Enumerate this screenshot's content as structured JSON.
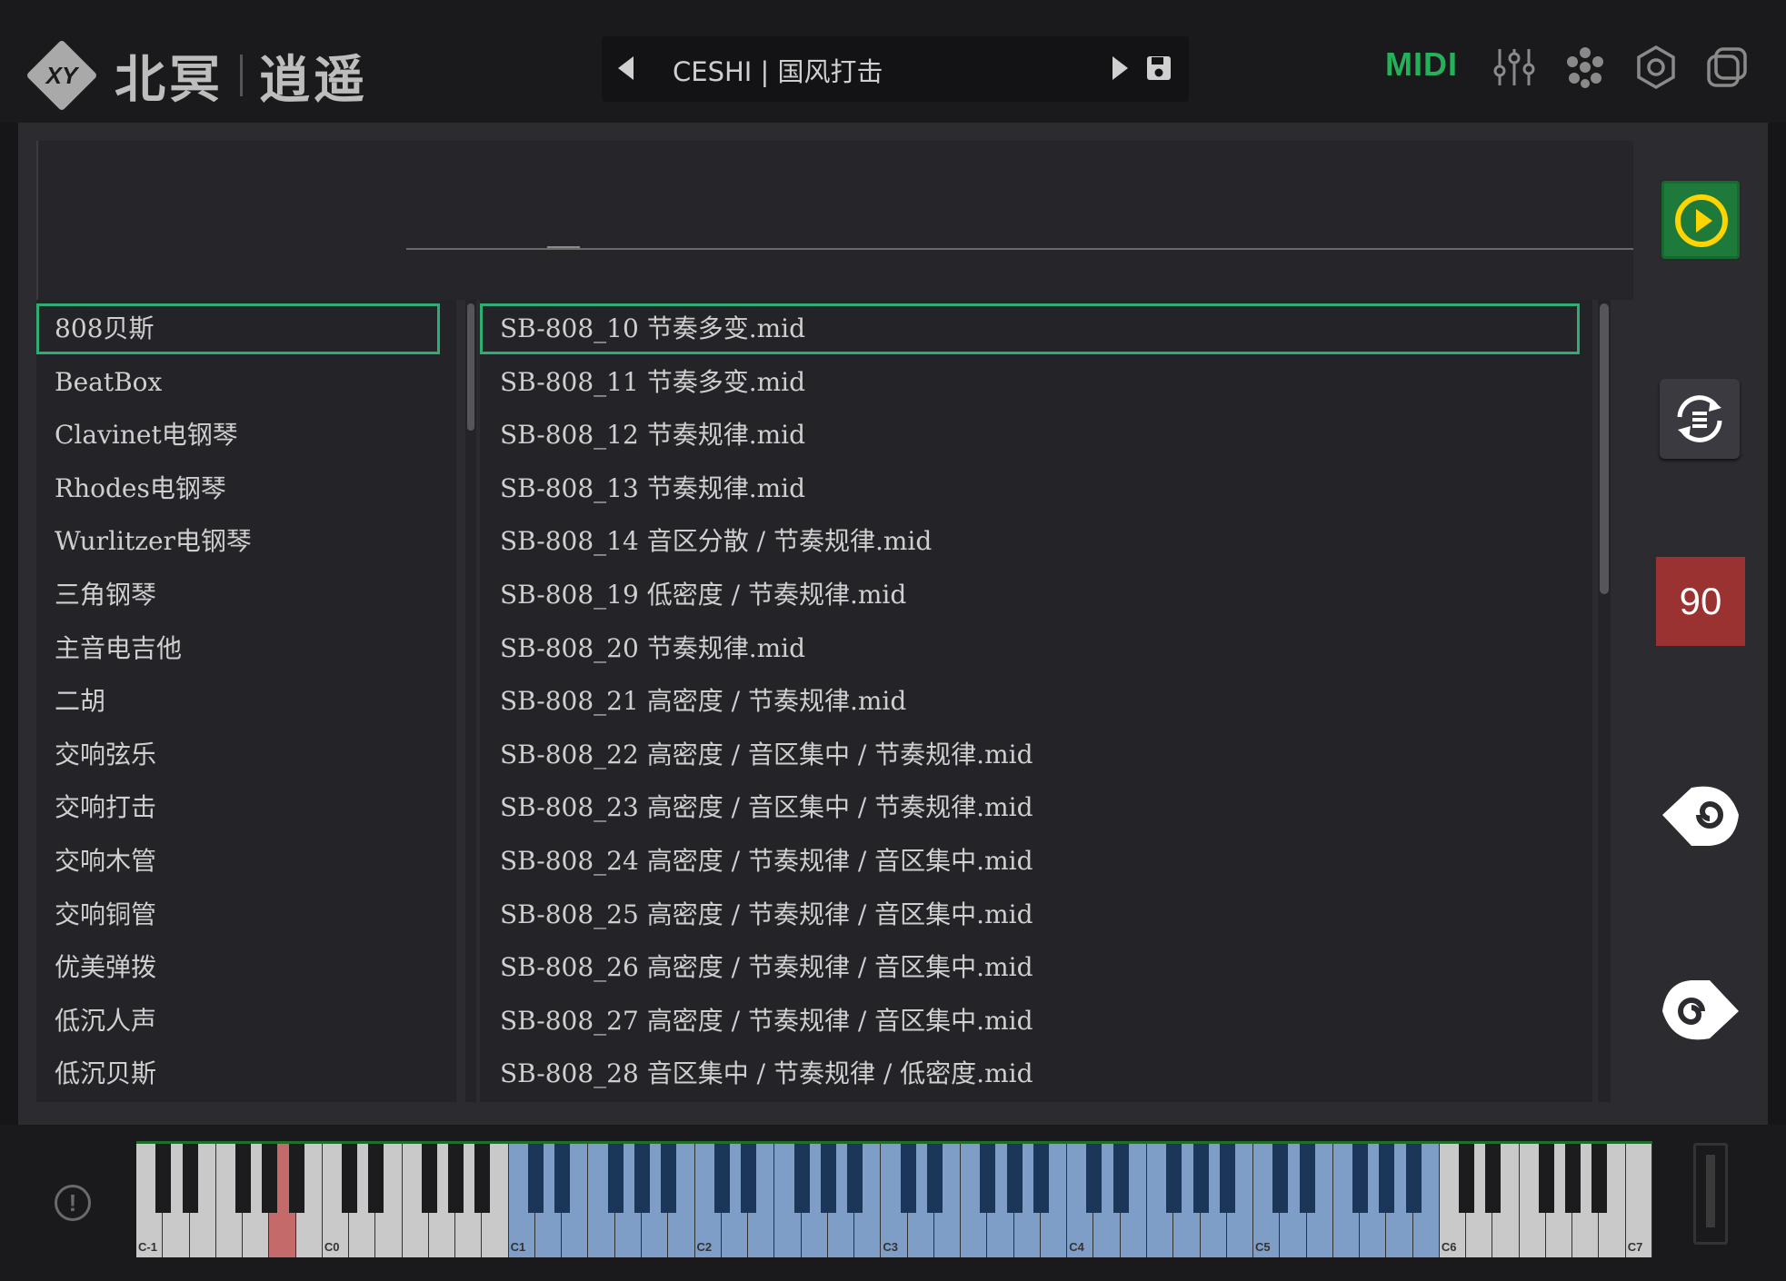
{
  "header": {
    "logo_badge": "XY",
    "logo_text_a": "北冥",
    "logo_text_b": "逍遥",
    "preset_name": "CESHI | 国风打击",
    "midi_label": "MIDI"
  },
  "icons": {
    "mixer": "mixer-sliders-icon",
    "nodes": "nodes-icon",
    "settings": "gear-icon",
    "layers": "layers-icon"
  },
  "colors": {
    "accent_green": "#2fae74",
    "midi_green": "#23b15a",
    "tempo_red": "#9a3232",
    "key_blue": "#7f9ec7"
  },
  "categories": [
    "808贝斯",
    "BeatBox",
    "Clavinet电钢琴",
    "Rhodes电钢琴",
    "Wurlitzer电钢琴",
    "三角钢琴",
    "主音电吉他",
    "二胡",
    "交响弦乐",
    "交响打击",
    "交响木管",
    "交响铜管",
    "优美弹拨",
    "低沉人声",
    "低沉贝斯"
  ],
  "selected_category": 0,
  "files": [
    "SB-808_10 节奏多变.mid",
    "SB-808_11 节奏多变.mid",
    "SB-808_12 节奏规律.mid",
    "SB-808_13 节奏规律.mid",
    "SB-808_14 音区分散 / 节奏规律.mid",
    "SB-808_19 低密度 / 节奏规律.mid",
    "SB-808_20 节奏规律.mid",
    "SB-808_21 高密度 / 节奏规律.mid",
    "SB-808_22 高密度 / 音区集中 / 节奏规律.mid",
    "SB-808_23 高密度 / 音区集中 / 节奏规律.mid",
    "SB-808_24 高密度 / 节奏规律 / 音区集中.mid",
    "SB-808_25 高密度 / 节奏规律 / 音区集中.mid",
    "SB-808_26 高密度 / 节奏规律 / 音区集中.mid",
    "SB-808_27 高密度 / 节奏规律 / 音区集中.mid",
    "SB-808_28 音区集中 / 节奏规律 / 低密度.mid"
  ],
  "selected_file": 0,
  "side": {
    "tempo": "90"
  },
  "keyboard": {
    "octave_labels": [
      "C-1",
      "C0",
      "C1",
      "C2",
      "C3",
      "C4",
      "C5",
      "C6",
      "C7"
    ],
    "info_icon": "!"
  }
}
